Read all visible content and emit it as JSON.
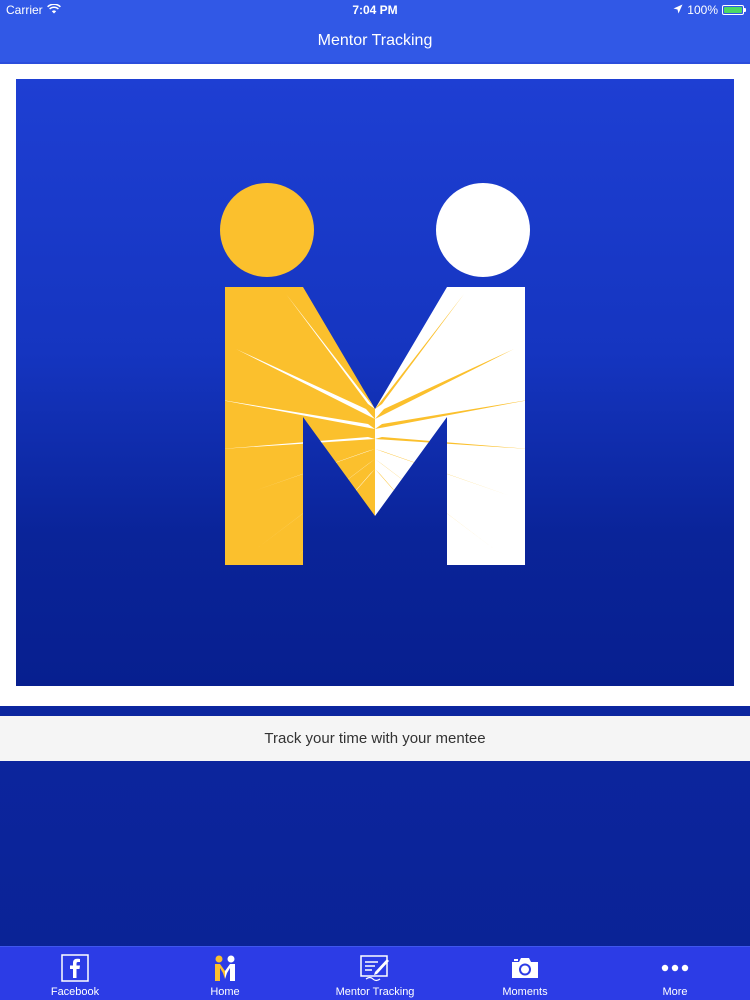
{
  "status_bar": {
    "carrier": "Carrier",
    "time": "7:04 PM",
    "battery": "100%",
    "battery_level": 1.0
  },
  "nav": {
    "title": "Mentor Tracking"
  },
  "hero": {
    "logo_icon": "mentor-m-logo-icon",
    "colors": {
      "gold": "#fbc02d",
      "white": "#ffffff",
      "blue": "#1535c0"
    }
  },
  "caption": {
    "text": "Track your time with your mentee"
  },
  "tabs": [
    {
      "label": "Facebook",
      "icon": "facebook-icon"
    },
    {
      "label": "Home",
      "icon": "home-m-logo-icon"
    },
    {
      "label": "Mentor Tracking",
      "icon": "edit-pen-icon"
    },
    {
      "label": "Moments",
      "icon": "camera-icon"
    },
    {
      "label": "More",
      "icon": "more-dots-icon"
    }
  ],
  "colors": {
    "bar_blue": "#3158e6",
    "tab_blue": "#2c3ce6",
    "battery_green": "#4cd964"
  }
}
